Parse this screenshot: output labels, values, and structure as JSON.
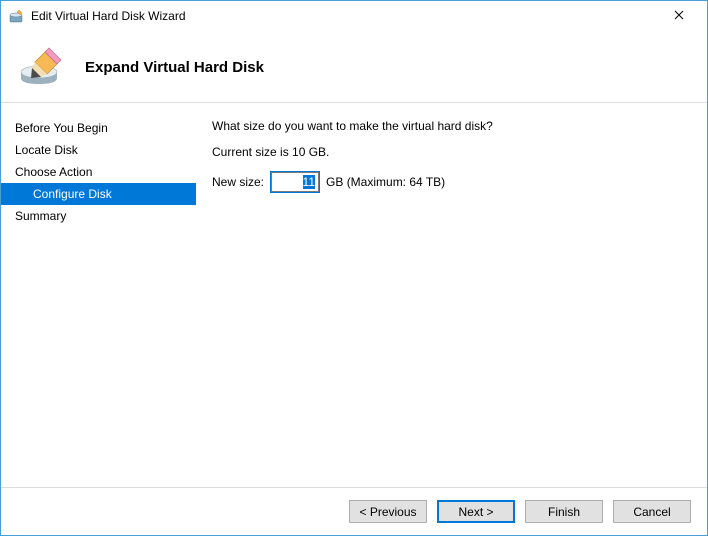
{
  "window": {
    "title": "Edit Virtual Hard Disk Wizard"
  },
  "header": {
    "title": "Expand Virtual Hard Disk"
  },
  "sidebar": {
    "items": [
      {
        "label": "Before You Begin",
        "indent": false,
        "active": false
      },
      {
        "label": "Locate Disk",
        "indent": false,
        "active": false
      },
      {
        "label": "Choose Action",
        "indent": false,
        "active": false
      },
      {
        "label": "Configure Disk",
        "indent": true,
        "active": true
      },
      {
        "label": "Summary",
        "indent": false,
        "active": false
      }
    ]
  },
  "content": {
    "question": "What size do you want to make the virtual hard disk?",
    "current_size_text": "Current size is 10 GB.",
    "new_size_label": "New size:",
    "new_size_value": "11",
    "unit_max_text": "GB (Maximum: 64 TB)"
  },
  "footer": {
    "previous": "< Previous",
    "next": "Next >",
    "finish": "Finish",
    "cancel": "Cancel"
  }
}
